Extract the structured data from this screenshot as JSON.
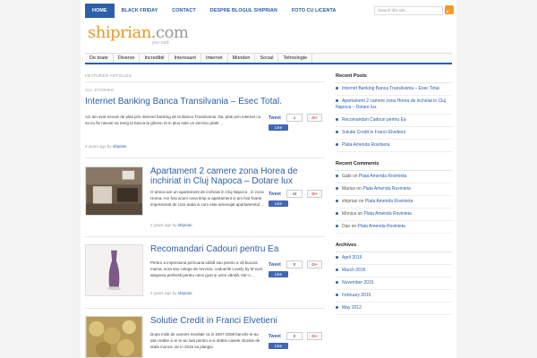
{
  "topnav": {
    "items": [
      {
        "label": "HOME",
        "active": true
      },
      {
        "label": "BLACK FRIDAY"
      },
      {
        "label": "CONTACT"
      },
      {
        "label": "DESPRE BLOGUL SHIPRIAN"
      },
      {
        "label": "FOTO CU LICENTA"
      }
    ],
    "search_placeholder": "Search this site..."
  },
  "logo": {
    "name": "shiprian",
    "suffix": ".com",
    "tagline": "you rock"
  },
  "catnav": [
    "De toate",
    "Diverse",
    "Incredibil",
    "Interesant",
    "Internet",
    "Monden",
    "Social",
    "Tehnologie"
  ],
  "main": {
    "featured_label": "FEATURED ARTICLES",
    "all_label": "ALL STORIES",
    "posts": [
      {
        "title": "Internet Banking Banca Transilvania – Esec Total.",
        "excerpt": "Azi am avut nevoie de plati prin internet banking de la Banca Transilvania. Da, plati prin internet ca sa nu fie nevoie sa merg la banca la ghiseu Si in plus este un serviciu platit ...",
        "meta_age": "2 years ago by",
        "author": "shiprian",
        "tweet_label": "Tweet",
        "tweet_count": "1",
        "gplus": "G+",
        "like": "Like"
      },
      {
        "title": "Apartament 2 camere zona Horea de inchiriat in Cluj Napoca – Dotare lux",
        "excerpt": "O amica are un apartament de inchiriat in Cluj Napoca , in zona Horea. Am fost acum ceva timp si apartament si am fost foarte impresionat de cum arata si cum este amenajat apartamentul ...",
        "meta_age": "2 years ago by",
        "author": "shiprian",
        "tweet_label": "Tweet",
        "tweet_count": "44",
        "gplus": "G+",
        "like": "Like"
      },
      {
        "title": "Recomandari Cadouri pentru Ea",
        "excerpt": "Pentru a impresiona persoana iubită sau pentru a vă bucura mama, sora sau colega de serviciu, cadourile Lovely by M sunt alegerea perfectă pentru orice gust și orice vârstă. Intr-o ...",
        "meta_age": "2 years ago by",
        "author": "shiprian",
        "tweet_label": "Tweet",
        "tweet_count": "0",
        "gplus": "G+",
        "like": "Like"
      },
      {
        "title": "Solutie Credit in Franci Elvetieni",
        "excerpt": "Dupa miile de oameni revoltati ca in 2007-2008 bancile le-au dat credite si ei le-au luat pentru a-si obtine casele obosite de stata munca, iar in 2015 sa plangia",
        "tweet_label": "Tweet",
        "tweet_count": "0",
        "gplus": "G+",
        "like": "Like"
      }
    ]
  },
  "sidebar": {
    "recent_posts_title": "Recent Posts",
    "recent_posts": [
      "Internet Banking Banca Transilvania – Esec Total.",
      "Apartament 2 camere zona Horea de inchiriat in Cluj Napoca – Dotare lux",
      "Recomandari Cadouri pentru Ea",
      "Solutie Credit in Franci Elvetieni",
      "Plata Amenda Rovinieta"
    ],
    "recent_comments_title": "Recent Comments",
    "recent_comments": [
      {
        "who": "Gabi",
        "on": "on",
        "post": "Plata Amenda Rovinieta"
      },
      {
        "who": "Marius",
        "on": "on",
        "post": "Plata Amenda Rovinieta"
      },
      {
        "who": "shiprian",
        "on": "on",
        "post": "Plata Amenda Rovinieta"
      },
      {
        "who": "Monica",
        "on": "on",
        "post": "Plata Amenda Rovinieta"
      },
      {
        "who": "Dan",
        "on": "on",
        "post": "Plata Amenda Rovinieta"
      }
    ],
    "archives_title": "Archives",
    "archives": [
      "April 2016",
      "March 2016",
      "November 2015",
      "February 2015",
      "May 2012"
    ]
  },
  "colors": {
    "accent": "#2d5ea8",
    "logo": "#e59a26",
    "rss": "#f39a2b",
    "facebook": "#4267b2",
    "gplus": "#d34836"
  }
}
